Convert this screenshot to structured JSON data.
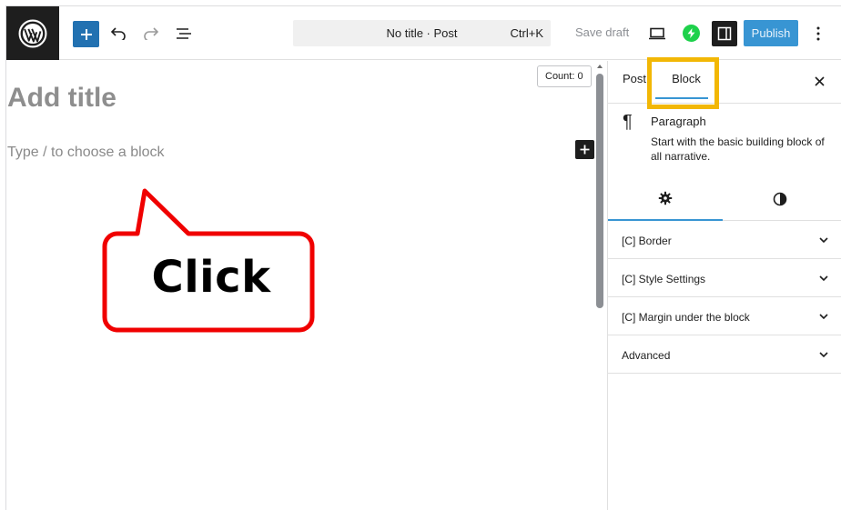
{
  "toolbar": {
    "command_title": "No title · Post",
    "command_shortcut": "Ctrl+K",
    "save_draft": "Save draft",
    "publish": "Publish"
  },
  "editor": {
    "count": "Count: 0",
    "title_placeholder": "Add title",
    "block_placeholder": "Type / to choose a block"
  },
  "annotation": {
    "callout_text": "Click",
    "callout_color": "#f00000",
    "highlight_color": "#f2b705"
  },
  "sidebar": {
    "tabs": [
      "Post",
      "Block"
    ],
    "active_tab": "Block",
    "block_card": {
      "title": "Paragraph",
      "description": "Start with the basic building block of all narrative."
    },
    "panels": [
      {
        "label": "[C] Border"
      },
      {
        "label": "[C] Style Settings"
      },
      {
        "label": "[C] Margin under the block"
      },
      {
        "label": "Advanced"
      }
    ]
  },
  "colors": {
    "accent": "#2271b1",
    "publish": "#3895d3",
    "dark": "#1e1e1e"
  }
}
